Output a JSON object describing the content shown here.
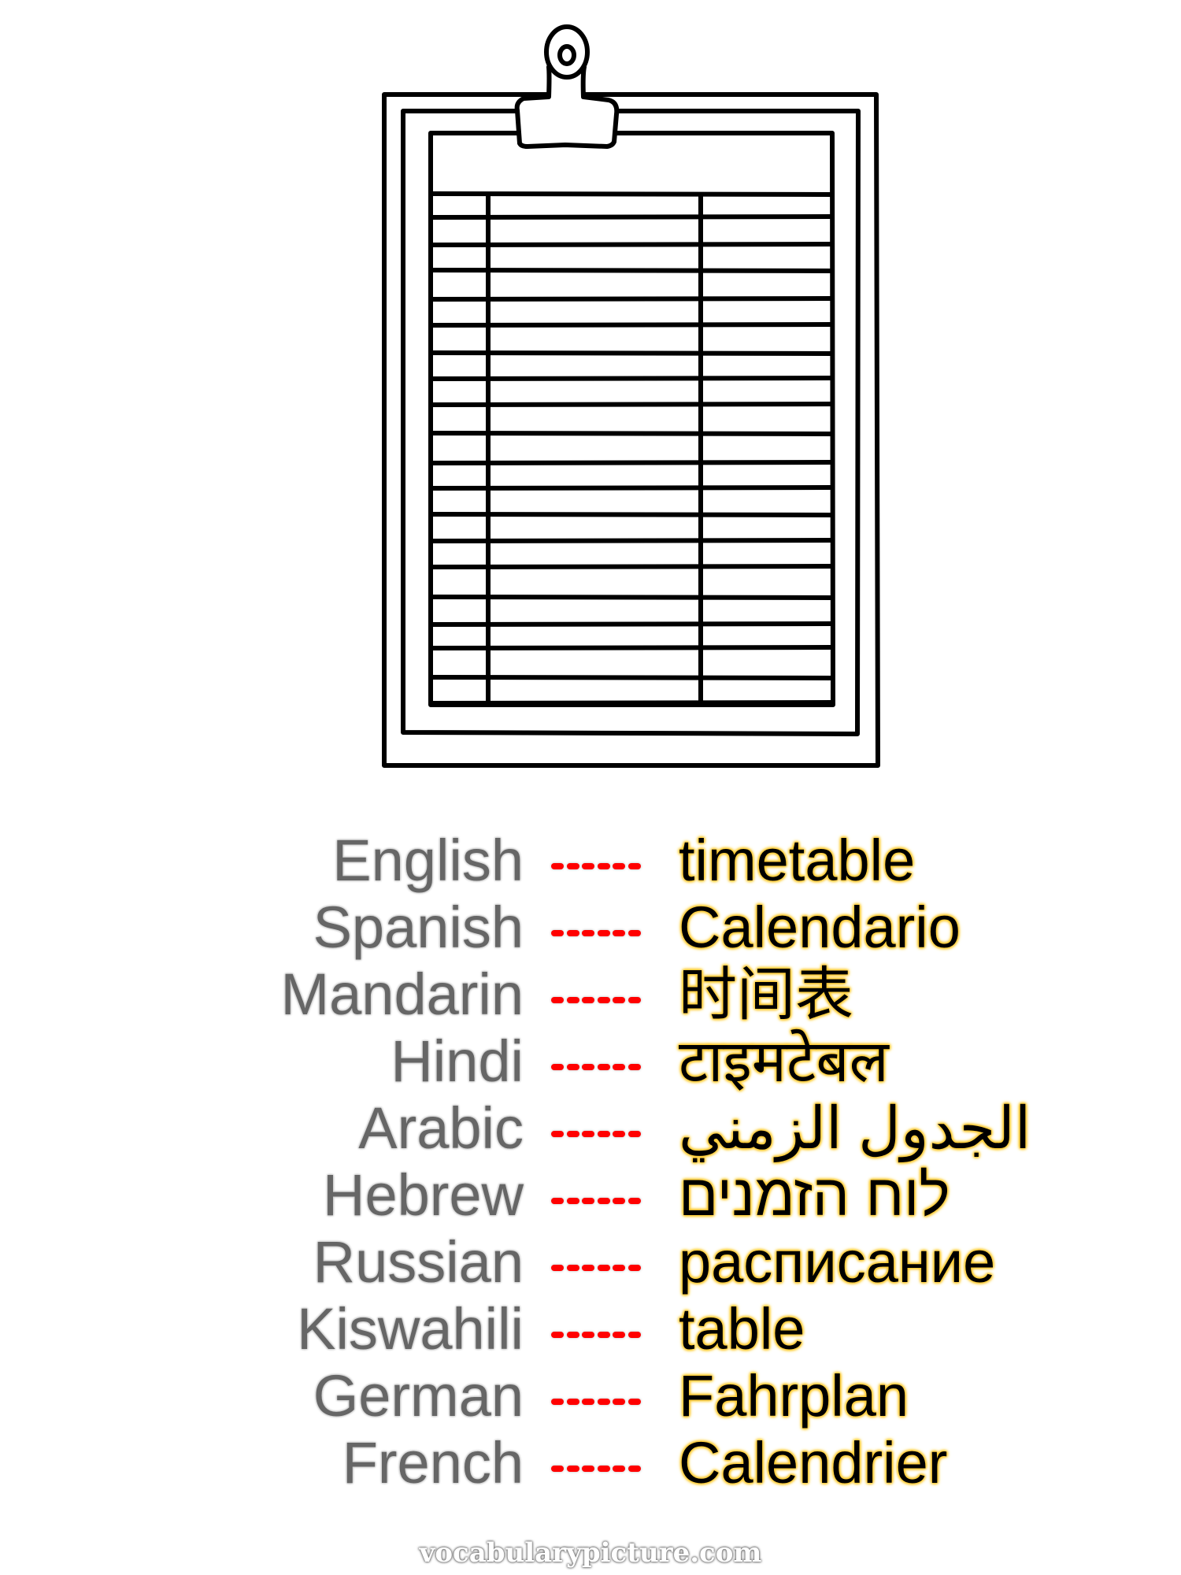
{
  "illustration": {
    "subject": "clipboard-with-timetable",
    "table_rows": 18,
    "table_columns": 3
  },
  "vocabulary": [
    {
      "language": "English",
      "separator": "------",
      "word": "timetable"
    },
    {
      "language": "Spanish",
      "separator": "------",
      "word": "Calendario"
    },
    {
      "language": "Mandarin",
      "separator": "------",
      "word": "时间表"
    },
    {
      "language": "Hindi",
      "separator": "------",
      "word": "टाइमटेबल"
    },
    {
      "language": "Arabic",
      "separator": "------",
      "word": "الجدول الزمني"
    },
    {
      "language": "Hebrew",
      "separator": "------",
      "word": "לוח הזמנים"
    },
    {
      "language": "Russian",
      "separator": "------",
      "word": "расписание"
    },
    {
      "language": "Kiswahili",
      "separator": "------",
      "word": "table"
    },
    {
      "language": "German",
      "separator": "------",
      "word": "Fahrplan"
    },
    {
      "language": "French",
      "separator": "------",
      "word": "Calendrier"
    }
  ],
  "colors": {
    "language_text": "#666666",
    "separator": "#ff0000",
    "word_text": "#000000",
    "word_glow": "#ffcc33"
  },
  "footer": {
    "site": "vocabularypicture.com"
  }
}
